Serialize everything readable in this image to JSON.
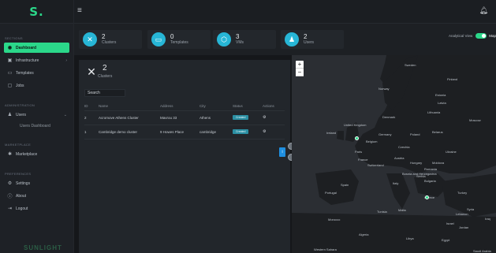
{
  "brand": {
    "logo": "S.",
    "name": "SUNLIGHT"
  },
  "sidebar": {
    "sections": [
      {
        "label": "SECTIONS"
      },
      {
        "label": "ADMINISTRATION"
      },
      {
        "label": "MARKETPLACE"
      },
      {
        "label": "PREFERENCES"
      }
    ],
    "items": [
      {
        "label": "Dashboard",
        "icon": "dashboard-icon"
      },
      {
        "label": "Infrastructure",
        "icon": "server-icon"
      },
      {
        "label": "Templates",
        "icon": "template-icon"
      },
      {
        "label": "Jobs",
        "icon": "job-icon"
      },
      {
        "label": "Users",
        "icon": "users-icon"
      },
      {
        "label": "Users Dashboard"
      },
      {
        "label": "Marketplace",
        "icon": "marketplace-icon"
      },
      {
        "label": "Settings",
        "icon": "gear-icon"
      },
      {
        "label": "About",
        "icon": "info-icon"
      },
      {
        "label": "Logout",
        "icon": "logout-icon"
      }
    ]
  },
  "stats": [
    {
      "value": "2",
      "label": "Clusters",
      "icon": "cluster-icon"
    },
    {
      "value": "0",
      "label": "Templates",
      "icon": "template-icon"
    },
    {
      "value": "3",
      "label": "VMs",
      "icon": "cube-icon"
    },
    {
      "value": "2",
      "label": "Users",
      "icon": "user-icon"
    }
  ],
  "view_toggle": {
    "label": "Analytical View",
    "right_label": "Map",
    "state": "on"
  },
  "clusters_panel": {
    "count": "2",
    "label": "Clusters",
    "search_placeholder": "Search",
    "columns": [
      "ID",
      "Name",
      "Address",
      "City",
      "Status",
      "Actions"
    ],
    "rows": [
      {
        "id": "2",
        "name": "Acromove Athens Cluster",
        "address": "Mavrou 33",
        "city": "Athens",
        "status": "Created"
      },
      {
        "id": "1",
        "name": "Cambridge demo cluster",
        "address": "9 Howes Place",
        "city": "cambridge",
        "status": "Created"
      }
    ]
  },
  "map": {
    "labels": [
      "Sweden",
      "Finland",
      "Norway",
      "Estonia",
      "Latvia",
      "Lithuania",
      "Denmark",
      "United Kingdom",
      "Ireland",
      "Belgium",
      "Germany",
      "Poland",
      "Belarus",
      "Czechia",
      "Ukraine",
      "Paris",
      "France",
      "Switzerland",
      "Austria",
      "Hungary",
      "Moldova",
      "Romania",
      "Bosnia and Herzegovina",
      "Serbia",
      "Bulgaria",
      "Spain",
      "Portugal",
      "Italy",
      "Greece",
      "Turkey",
      "Tunisia",
      "Malta",
      "Algeria",
      "Morocco",
      "Libya",
      "Egypt",
      "Syria",
      "Lebanon",
      "Israel",
      "Iraq",
      "Jordan",
      "Moscow",
      "Saudi Arabia",
      "Western Sahara"
    ],
    "zoom_in": "+",
    "zoom_out": "−",
    "markers": [
      "Cambridge",
      "Athens"
    ]
  },
  "floating": {
    "button_label": "i"
  }
}
